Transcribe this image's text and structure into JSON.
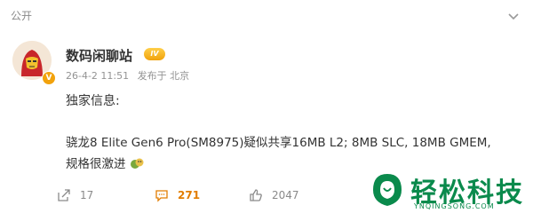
{
  "top": {
    "visibility": "公开"
  },
  "user": {
    "name": "数码闲聊站",
    "level_badge": "IV",
    "verified_badge": "V"
  },
  "meta": {
    "date": "26-4-2 11:51",
    "source": "发布于 北京"
  },
  "post": {
    "line1": "独家信息:",
    "line2": "骁龙8 Elite Gen6 Pro(SM8975)疑似共享16MB L2; 8MB SLC, 18MB GMEM,",
    "line3": "规格很激进"
  },
  "actions": {
    "share_count": "17",
    "comment_count": "271",
    "like_count": "2047"
  },
  "watermark": {
    "title": "轻松科技",
    "sub": "YNQINGSONG.COM"
  },
  "colors": {
    "accent": "#e27d00",
    "brand": "#0a8a4c",
    "badge": "#f2a20c"
  },
  "icons": [
    "chevron-down-icon",
    "avatar",
    "verified-badge-icon",
    "level-badge-icon",
    "share-icon",
    "comment-icon",
    "like-icon",
    "emoji-icon",
    "watermark-logo-icon"
  ]
}
